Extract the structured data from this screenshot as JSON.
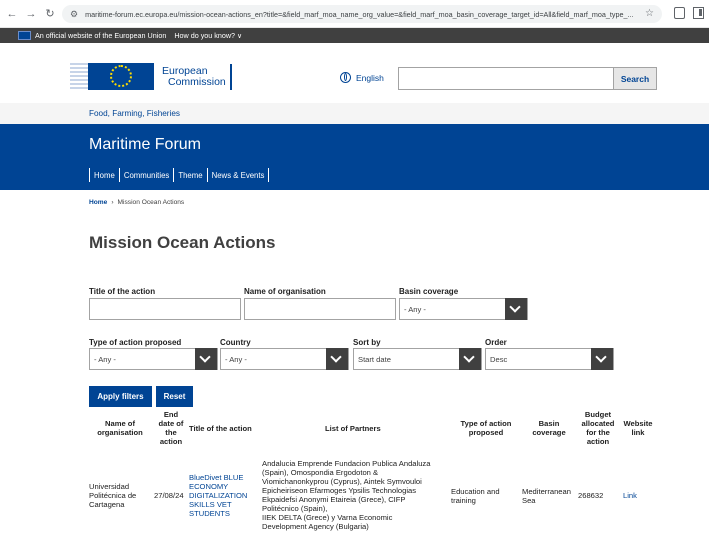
{
  "browser": {
    "url": "maritime-forum.ec.europa.eu/mission-ocean-actions_en?title=&field_marf_moa_name_org_value=&field_marf_moa_basin_coverage_target_id=All&field_marf_moa_type_..."
  },
  "eu_banner": {
    "text": "An official website of the European Union",
    "link": "How do you know? ∨"
  },
  "header": {
    "logo_line1": "European",
    "logo_line2": "Commission",
    "language": "English",
    "search_placeholder": "",
    "search_button": "Search"
  },
  "site_tag": "Food, Farming, Fisheries",
  "site_title": "Maritime Forum",
  "nav": [
    "Home",
    "Communities",
    "Theme",
    "News & Events"
  ],
  "breadcrumb": {
    "home": "Home",
    "current": "Mission Ocean Actions"
  },
  "page_title": "Mission Ocean Actions",
  "filters": {
    "title_label": "Title of the action",
    "org_label": "Name of organisation",
    "basin_label": "Basin coverage",
    "basin_value": "- Any -",
    "type_label": "Type of action proposed",
    "type_value": "- Any -",
    "country_label": "Country",
    "country_value": "- Any -",
    "sort_label": "Sort by",
    "sort_value": "Start date",
    "order_label": "Order",
    "order_value": "Desc",
    "apply_button": "Apply filters",
    "reset_button": "Reset"
  },
  "table": {
    "headers": {
      "org": [
        "Name of",
        "organisation"
      ],
      "end_date": [
        "End",
        "date of",
        "the",
        "action"
      ],
      "title": "Title of the action",
      "partners": "List of Partners",
      "type": [
        "Type of action",
        "proposed"
      ],
      "basin": [
        "Basin",
        "coverage"
      ],
      "budget": [
        "Budget",
        "allocated",
        "for the",
        "action"
      ],
      "website": [
        "Website",
        "link"
      ]
    },
    "rows": [
      {
        "org": [
          "Universidad",
          "Politécnica de",
          "Cartagena"
        ],
        "end_date": "27/08/24",
        "title": [
          "BlueDivet BLUE",
          "ECONOMY",
          "DIGITALIZATION",
          "SKILLS VET",
          "STUDENTS"
        ],
        "partners": [
          "Andalucia Emprende Fundacion Publica Andaluza",
          "(Spain), Omospondia Ergodoton &",
          "Viomichanonkyprou (Cyprus), Aintek Symvouloi",
          "Epicheiriseon Efarmoges Ypsilis Technologias",
          "Ekpaidefsi Anonymi Etaireia (Grece), CIFP",
          "Politécnico (Spain),",
          "IIEK DELTA (Grece) y Varna Economic",
          "Development Agency (Bulgaria)"
        ],
        "type": [
          "Education and",
          "training"
        ],
        "basin": [
          "Mediterranean",
          "Sea"
        ],
        "budget": "268632",
        "website": "Link"
      }
    ]
  }
}
